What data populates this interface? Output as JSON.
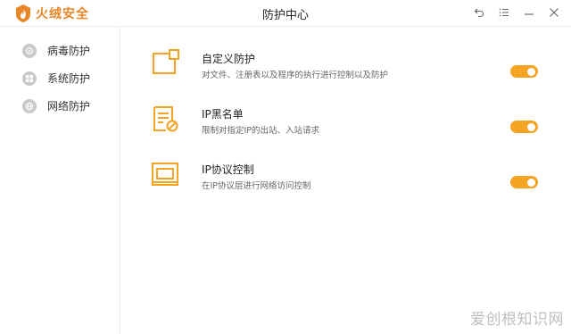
{
  "app": {
    "logo_text": "火绒安全",
    "window_title": "防护中心",
    "controls": [
      {
        "name": "back-button",
        "icon": "back-arrow-icon"
      },
      {
        "name": "menu-button",
        "icon": "menu-icon"
      },
      {
        "name": "minimize-button",
        "icon": "minimize-icon"
      },
      {
        "name": "close-button",
        "icon": "close-icon"
      }
    ]
  },
  "sidebar": {
    "items": [
      {
        "label": "病毒防护",
        "icon": "virus-protection-icon"
      },
      {
        "label": "系统防护",
        "icon": "system-protection-icon"
      },
      {
        "label": "网络防护",
        "icon": "network-protection-icon"
      }
    ]
  },
  "rules": [
    {
      "title": "自定义防护",
      "desc": "对文件、注册表以及程序的执行进行控制以及防护",
      "icon": "custom-protection-icon",
      "enabled": true
    },
    {
      "title": "IP黑名单",
      "desc": "限制对指定IP的出站、入站请求",
      "icon": "ip-blacklist-icon",
      "enabled": true
    },
    {
      "title": "IP协议控制",
      "desc": "在IP协议层进行网络访问控制",
      "icon": "ip-protocol-icon",
      "enabled": true
    }
  ],
  "watermark": "爱创根知识网",
  "colors": {
    "accent": "#f5a323",
    "brand": "#e8862a",
    "sidebar_icon": "#c9c9c9"
  }
}
